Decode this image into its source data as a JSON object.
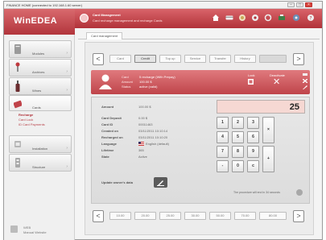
{
  "window": {
    "title": "FINANCE HOME (connected to 192.168.1.60 server)",
    "minimize": "–",
    "maximize": "□",
    "close": "×"
  },
  "sidebar": {
    "brand": "WinEDEA",
    "items": [
      {
        "label": "Modules",
        "icon": "module-icon"
      },
      {
        "label": "Archives",
        "icon": "wrench-icon"
      },
      {
        "label": "Wines",
        "icon": "bottle-icon"
      },
      {
        "label": "Cards",
        "icon": "card-icon"
      },
      {
        "label": "Installation",
        "icon": "installation-icon"
      },
      {
        "label": "Structure",
        "icon": "structure-icon"
      }
    ],
    "subitems": [
      "Recharge",
      "Card Lock",
      "ID Card Payments"
    ],
    "footer": [
      "WEB",
      "Manual Website"
    ]
  },
  "header": {
    "title": "Card Management",
    "subtitle": "Card recharge management and recharge Cards",
    "icons": [
      "home-icon",
      "card-icon",
      "money-icon",
      "settings-icon",
      "refresh-icon",
      "printer-icon",
      "network-icon",
      "help-icon"
    ]
  },
  "tabs": [
    "Card management"
  ],
  "top_strip": {
    "prev": "<",
    "next": ">",
    "items": [
      "Card",
      "Credit",
      "Top up",
      "Service",
      "Transfer",
      "History",
      ""
    ],
    "selected_index": 1
  },
  "card": {
    "labels": [
      "Card",
      "Amount",
      "Status"
    ],
    "values": [
      "5 recharge (With Prepay)",
      "100.00 $",
      "active (valid)"
    ],
    "actions": [
      {
        "label": "Lock",
        "icon": "lock-icon"
      },
      {
        "label": "Deactivate",
        "icon": "close-icon"
      }
    ],
    "side_icons": [
      "print-icon",
      "delete-icon",
      "edit-icon"
    ]
  },
  "details": {
    "rows": [
      {
        "label": "Amount",
        "value": "100.00 $"
      },
      {
        "label": "Card Deposit",
        "value": "0.00 $"
      },
      {
        "label": "Card ID",
        "value": "00011463"
      },
      {
        "label": "Created on",
        "value": "03/11/2011 10:10:14"
      },
      {
        "label": "Recharged on",
        "value": "03/11/2011 10:10:20"
      },
      {
        "label": "Language",
        "value": "English (default)"
      },
      {
        "label": "Lifetime",
        "value": "365"
      },
      {
        "label": "State",
        "value": "Active"
      }
    ],
    "update_label": "Update owner's data",
    "update_icon": "edit-owner-icon",
    "message": "The procedure will end in 34 seconds"
  },
  "keypad": {
    "display": "25",
    "keys": [
      "1",
      "2",
      "3",
      "4",
      "5",
      "6",
      "7",
      "8",
      "9",
      "-",
      "0",
      "c"
    ],
    "side_keys": [
      "×",
      "+"
    ]
  },
  "bottom_strip": {
    "prev": "<",
    "next": ">",
    "items": [
      "10.00",
      "20.00",
      "25.00",
      "30.00",
      "50.00",
      "70.00",
      "80.00"
    ]
  },
  "colors": {
    "brand_red": "#c0434a",
    "card_red": "#d25c61",
    "display_pink": "#f6d8d3"
  }
}
